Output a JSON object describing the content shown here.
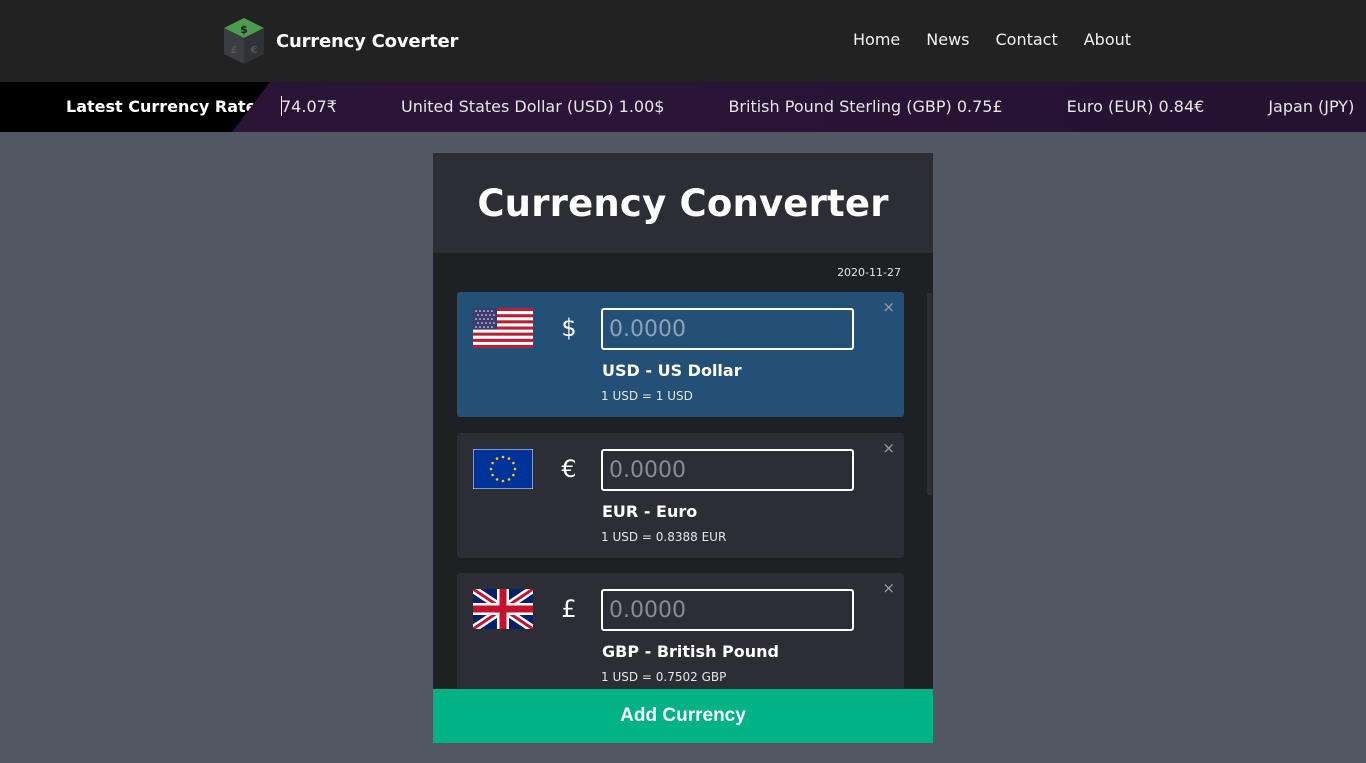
{
  "header": {
    "brand": "Currency Coverter",
    "logo_icon": "currency-cube-icon",
    "nav": [
      "Home",
      "News",
      "Contact",
      "About"
    ]
  },
  "ticker": {
    "title": "Latest Currency Rate",
    "items": [
      "74.07₹",
      "United States Dollar (USD) 1.00$",
      "British Pound Sterling (GBP) 0.75£",
      "Euro (EUR) 0.84€",
      "Japan (JPY)"
    ]
  },
  "converter": {
    "title": "Currency Converter",
    "date": "2020-11-27",
    "currencies": [
      {
        "flag": "us-flag-icon",
        "symbol": "$",
        "placeholder": "0.0000",
        "name": "USD - US Dollar",
        "rate": "1 USD = 1 USD",
        "close": "×"
      },
      {
        "flag": "eu-flag-icon",
        "symbol": "€",
        "placeholder": "0.0000",
        "name": "EUR - Euro",
        "rate": "1 USD = 0.8388 EUR",
        "close": "×"
      },
      {
        "flag": "uk-flag-icon",
        "symbol": "£",
        "placeholder": "0.0000",
        "name": "GBP - British Pound",
        "rate": "1 USD = 0.7502 GBP",
        "close": "×"
      }
    ],
    "add_button": "Add Currency"
  },
  "colors": {
    "page_bg": "#525863",
    "header_bg": "#222222",
    "active_card": "#244f76",
    "card": "#2c2d35",
    "accent": "#00b386"
  }
}
